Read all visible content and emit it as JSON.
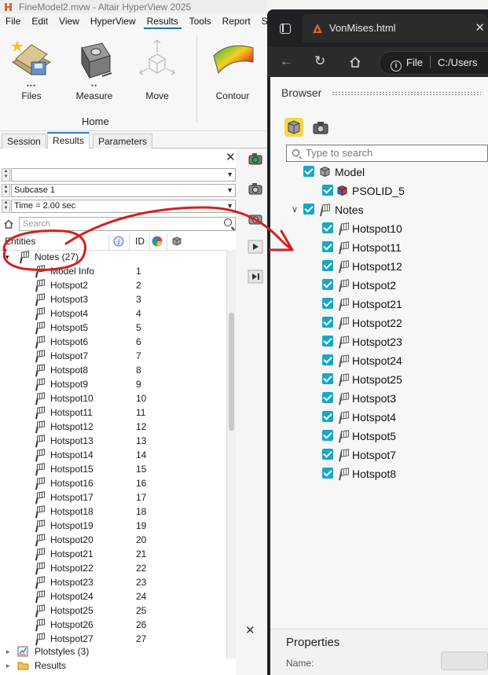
{
  "app": {
    "title": "FineModel2.mvw - Altair HyperView 2025",
    "menu": [
      "File",
      "Edit",
      "View",
      "HyperView",
      "Results",
      "Tools",
      "Report",
      "Saf"
    ],
    "ribbon": {
      "buttons": [
        "Files",
        "Measure",
        "Move",
        "Contour"
      ],
      "group_label": "Home"
    },
    "panel_tabs": [
      "Session",
      "Results",
      "Parameters"
    ],
    "combos": {
      "blank": "",
      "subcase": "Subcase 1",
      "time": "Time = 2.00 sec"
    },
    "search_placeholder": "Search",
    "columns": {
      "entities": "Entities",
      "id": "ID"
    },
    "tree": {
      "notes_label": "Notes (27)",
      "notes": [
        {
          "name": "Model Info",
          "id": "1"
        },
        {
          "name": "Hotspot2",
          "id": "2"
        },
        {
          "name": "Hotspot3",
          "id": "3"
        },
        {
          "name": "Hotspot4",
          "id": "4"
        },
        {
          "name": "Hotspot5",
          "id": "5"
        },
        {
          "name": "Hotspot6",
          "id": "6"
        },
        {
          "name": "Hotspot7",
          "id": "7"
        },
        {
          "name": "Hotspot8",
          "id": "8"
        },
        {
          "name": "Hotspot9",
          "id": "9"
        },
        {
          "name": "Hotspot10",
          "id": "10"
        },
        {
          "name": "Hotspot11",
          "id": "11"
        },
        {
          "name": "Hotspot12",
          "id": "12"
        },
        {
          "name": "Hotspot13",
          "id": "13"
        },
        {
          "name": "Hotspot14",
          "id": "14"
        },
        {
          "name": "Hotspot15",
          "id": "15"
        },
        {
          "name": "Hotspot16",
          "id": "16"
        },
        {
          "name": "Hotspot17",
          "id": "17"
        },
        {
          "name": "Hotspot18",
          "id": "18"
        },
        {
          "name": "Hotspot19",
          "id": "19"
        },
        {
          "name": "Hotspot20",
          "id": "20"
        },
        {
          "name": "Hotspot21",
          "id": "21"
        },
        {
          "name": "Hotspot22",
          "id": "22"
        },
        {
          "name": "Hotspot23",
          "id": "23"
        },
        {
          "name": "Hotspot24",
          "id": "24"
        },
        {
          "name": "Hotspot25",
          "id": "25"
        },
        {
          "name": "Hotspot26",
          "id": "26"
        },
        {
          "name": "Hotspot27",
          "id": "27"
        }
      ],
      "plotstyles_label": "Plotstyles (3)",
      "results_label": "Results"
    }
  },
  "browser": {
    "tab_title": "VonMises.html",
    "address_scheme": "File",
    "address_path": "C:/Users",
    "panel_title": "Browser",
    "search_placeholder": "Type to search",
    "model_label": "Model",
    "part_label": "PSOLID_5",
    "notes_label": "Notes",
    "notes": [
      "Hotspot10",
      "Hotspot11",
      "Hotspot12",
      "Hotspot2",
      "Hotspot21",
      "Hotspot22",
      "Hotspot23",
      "Hotspot24",
      "Hotspot25",
      "Hotspot3",
      "Hotspot4",
      "Hotspot5",
      "Hotspot7",
      "Hotspot8"
    ],
    "properties_title": "Properties",
    "name_label": "Name:"
  },
  "colors": {
    "accent": "#1b6ec2",
    "checkbox": "#17a7c7",
    "annotation": "#d42020",
    "browser_dark": "#202124"
  }
}
